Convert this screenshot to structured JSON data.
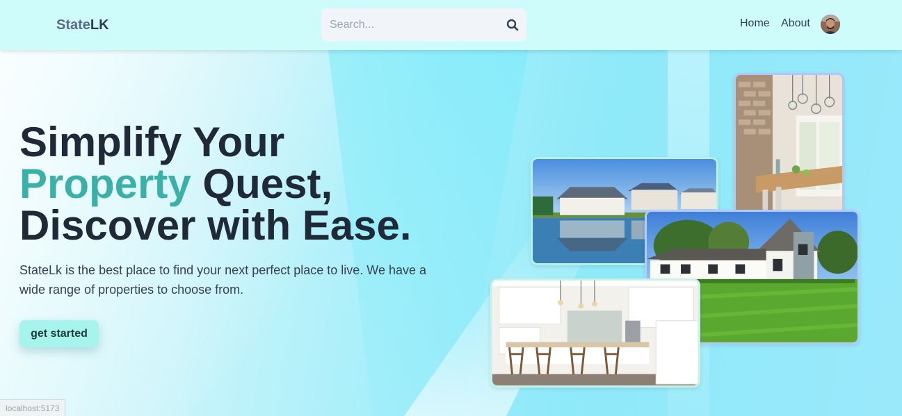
{
  "header": {
    "logo_part1": "State",
    "logo_part2": "LK",
    "search_placeholder": "Search...",
    "search_icon": "magnifier-icon",
    "nav": [
      {
        "label": "Home"
      },
      {
        "label": "About"
      }
    ],
    "avatar": "user-avatar"
  },
  "hero": {
    "title_line1": "Simplify Your",
    "title_accent": "Property",
    "title_line2_rest": " Quest,",
    "title_line3": "Discover with Ease.",
    "description": "StateLk is the best place to find your next perfect place to live. We have a wide range of properties to choose from.",
    "cta_label": "get started"
  },
  "colors": {
    "header_bg": "#cdfcfb",
    "accent_text": "#3bb0a8",
    "cta_bg": "#a6f4ec",
    "heading": "#1f2937"
  },
  "gallery": [
    {
      "name": "interior-dining-photo"
    },
    {
      "name": "lakeside-houses-photo"
    },
    {
      "name": "white-house-lawn-photo"
    },
    {
      "name": "kitchen-island-photo"
    }
  ],
  "status_bar": "localhost:5173"
}
